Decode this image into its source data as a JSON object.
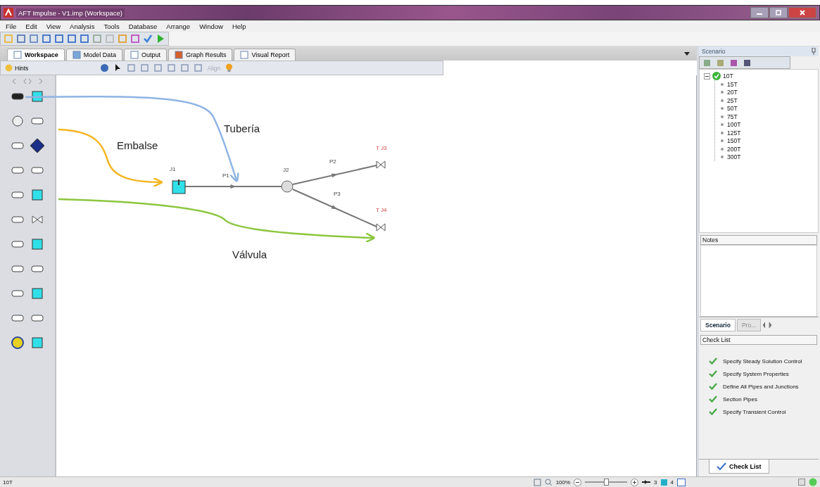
{
  "window": {
    "title": "AFT Impulse - V1.imp (Workspace)"
  },
  "menu": [
    "File",
    "Edit",
    "View",
    "Analysis",
    "Tools",
    "Database",
    "Arrange",
    "Window",
    "Help"
  ],
  "tabs": [
    {
      "label": "Workspace",
      "selected": true
    },
    {
      "label": "Model Data",
      "selected": false
    },
    {
      "label": "Output",
      "selected": false
    },
    {
      "label": "Graph Results",
      "selected": false
    },
    {
      "label": "Visual Report",
      "selected": false
    }
  ],
  "workspace_toolbar": {
    "hints": "Hints",
    "align": {
      "label": "Align",
      "disabled": true
    }
  },
  "diagram": {
    "junctions": [
      {
        "label": "J1",
        "kind": "tank"
      },
      {
        "label": "J2",
        "kind": "branch"
      },
      {
        "label": "T J3",
        "kind": "valve"
      },
      {
        "label": "T J4",
        "kind": "valve"
      }
    ],
    "pipes": [
      {
        "label": "P1"
      },
      {
        "label": "P2"
      },
      {
        "label": "P3"
      }
    ],
    "annotations": [
      {
        "label": "Tubería",
        "color": "#8eb4e3"
      },
      {
        "label": "Embalse",
        "color": "#f5b622"
      },
      {
        "label": "Válvula",
        "color": "#8cc63f"
      }
    ]
  },
  "scenario": {
    "title": "Scenario",
    "tree": [
      {
        "label": "10T",
        "expanded": true,
        "children": [
          {
            "label": "15T"
          },
          {
            "label": "20T"
          },
          {
            "label": "25T"
          },
          {
            "label": "50T"
          },
          {
            "label": "75T"
          },
          {
            "label": "100T"
          },
          {
            "label": "125T"
          },
          {
            "label": "150T"
          },
          {
            "label": "200T"
          },
          {
            "label": "300T"
          }
        ]
      }
    ]
  },
  "notes": {
    "title": "Notes"
  },
  "panel_tabs": [
    {
      "label": "Scenario",
      "selected": true
    },
    {
      "label": "Pro...",
      "selected": false
    }
  ],
  "check_list": {
    "title": "Check List",
    "items": [
      {
        "label": "Specify Steady Solution Control",
        "checked": true
      },
      {
        "label": "Specify System Properties",
        "checked": true
      },
      {
        "label": "Define All Pipes and Junctions",
        "checked": true
      },
      {
        "label": "Section Pipes",
        "checked": true
      },
      {
        "label": "Specify Transient Control",
        "checked": true
      }
    ],
    "tab": "Check List"
  },
  "status_bar": {
    "scenario": "10T",
    "zoom": "100%",
    "zoom_slider": {
      "level": 0.5
    },
    "pipes": "3",
    "junctions": "4"
  }
}
